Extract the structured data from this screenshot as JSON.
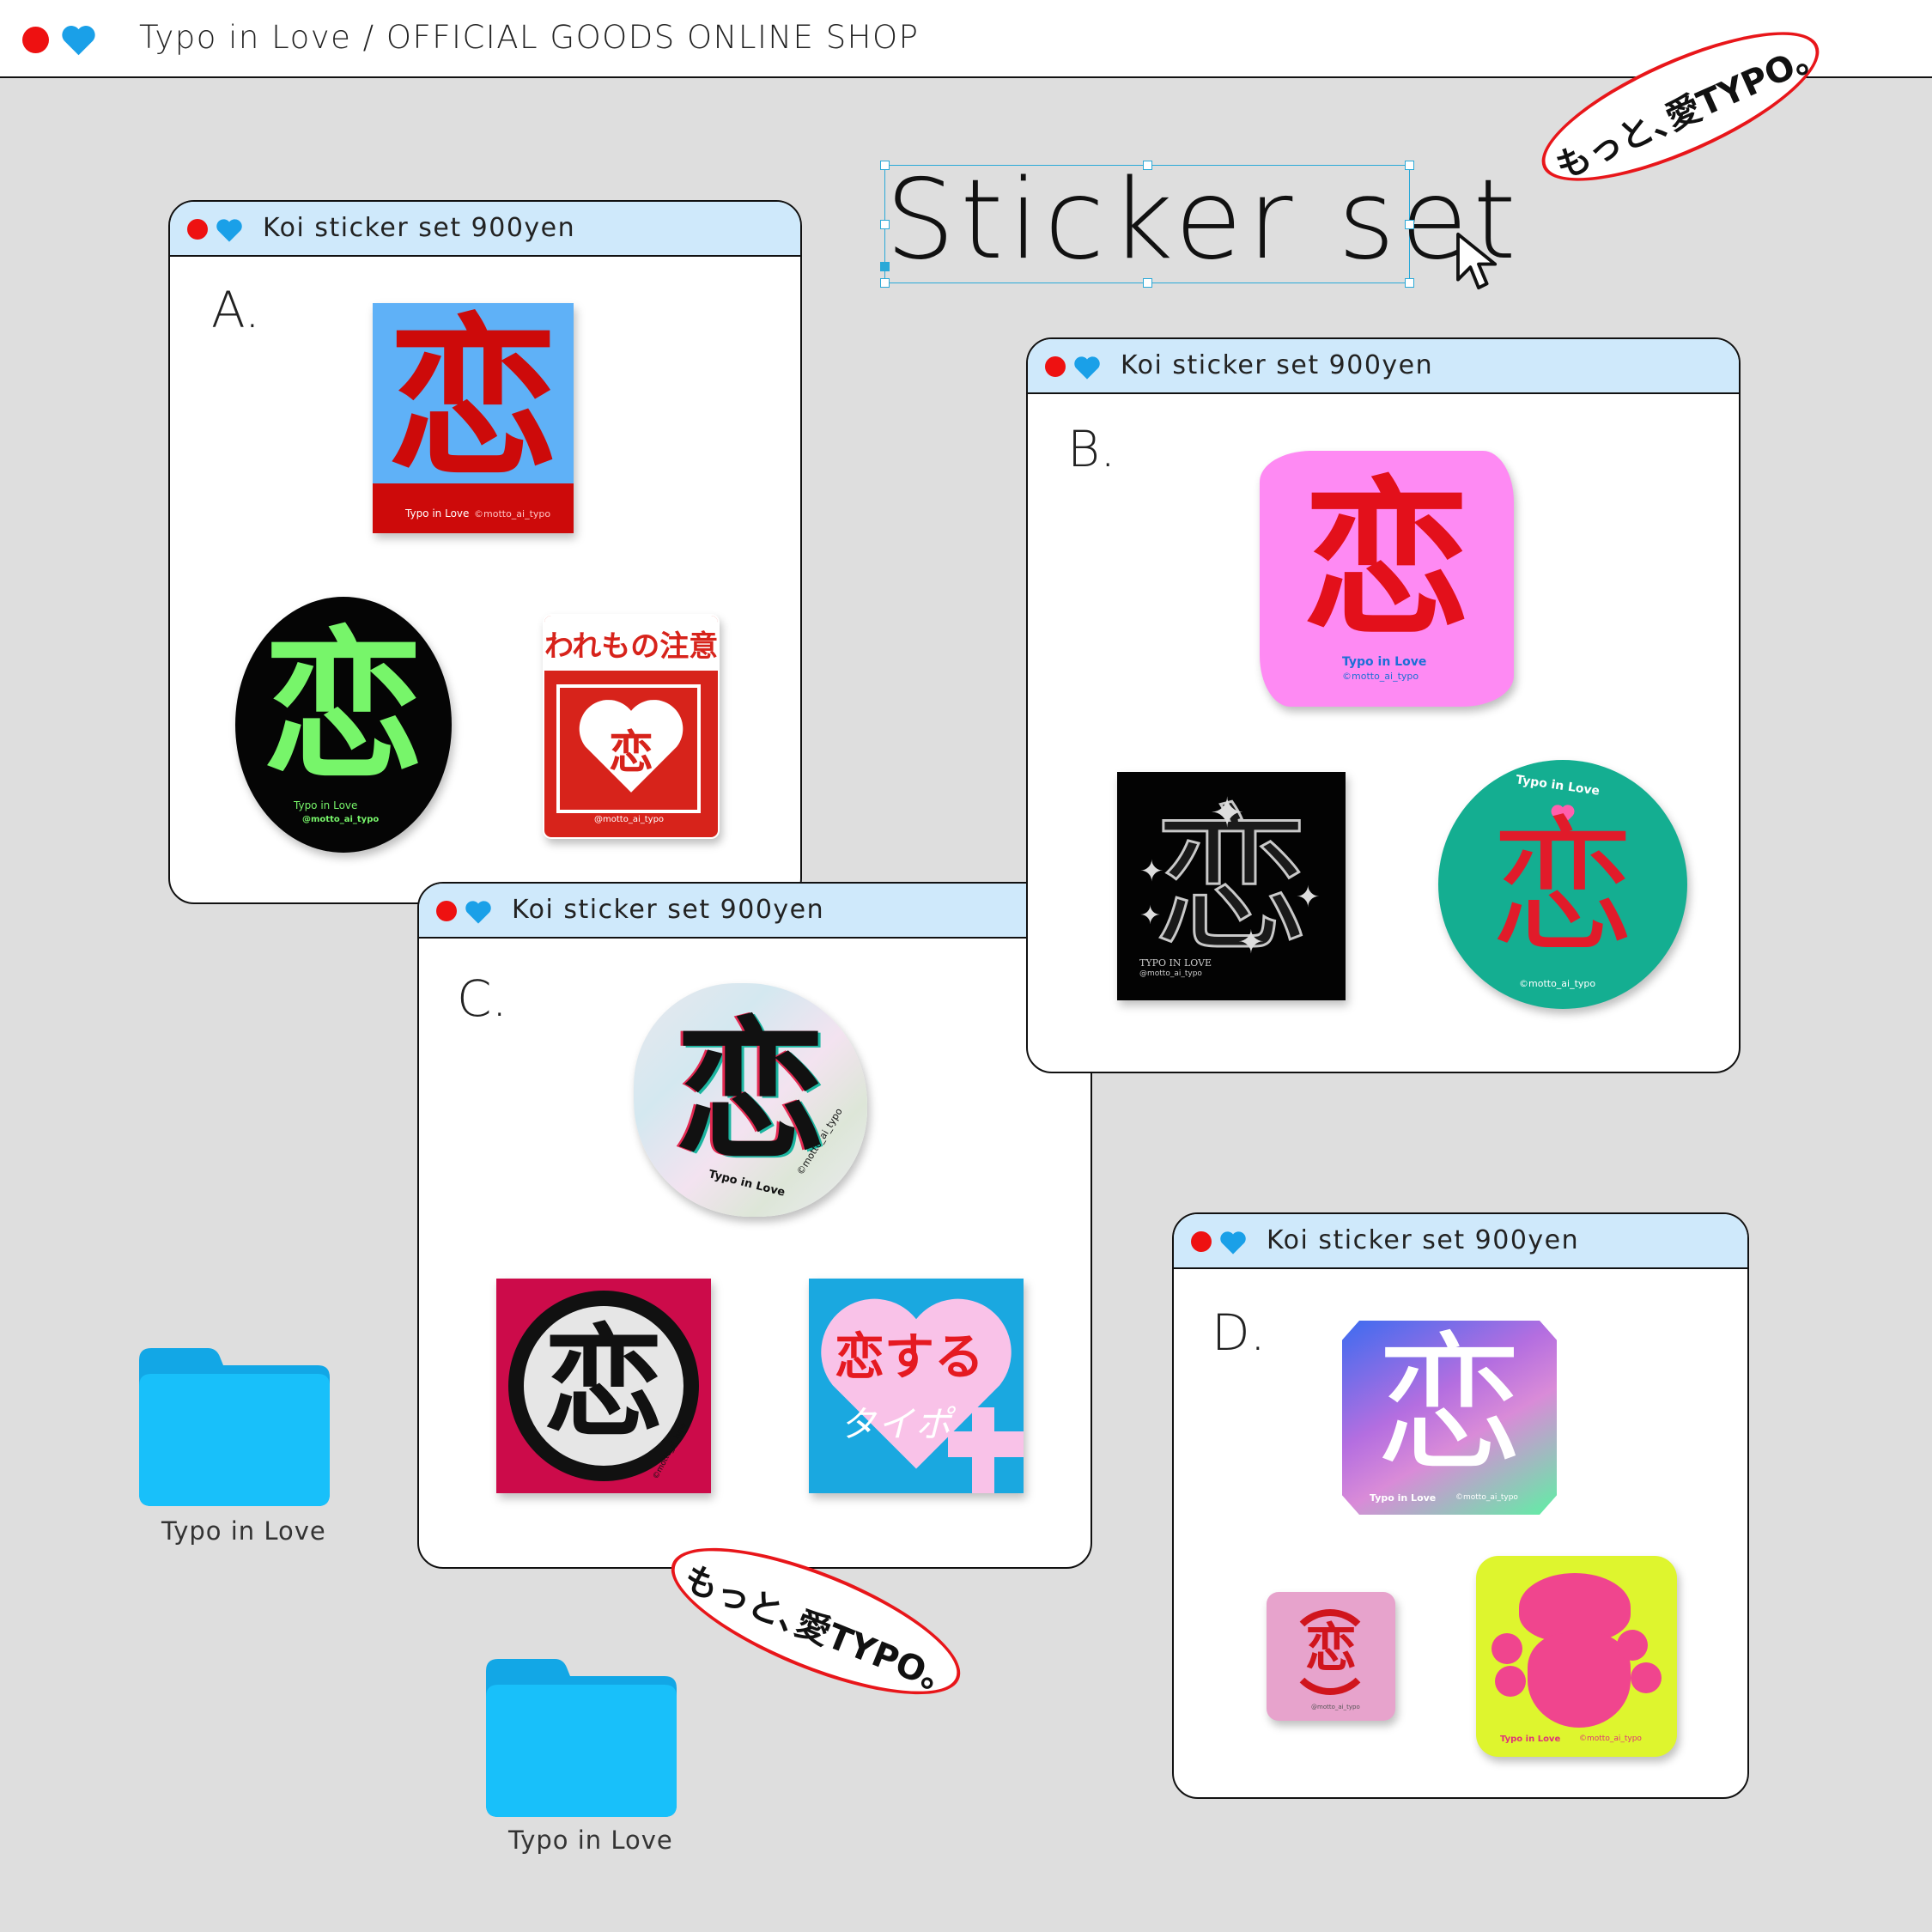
{
  "topbar": {
    "title": "Typo in Love / OFFICIAL GOODS ONLINE SHOP"
  },
  "page_title": "Sticker set",
  "badge_text": "もっと､愛TYPO｡",
  "windows": [
    {
      "title": "Koi sticker set  900yen",
      "letter": "A."
    },
    {
      "title": "Koi sticker set  900yen",
      "letter": "B."
    },
    {
      "title": "Koi sticker set  900yen",
      "letter": "C."
    },
    {
      "title": "Koi sticker set  900yen",
      "letter": "D."
    }
  ],
  "stickers": {
    "kanji": "恋",
    "brand": "Typo in Love",
    "handle": "@motto_ai_typo",
    "copyright_handle": "©motto_ai_typo",
    "fragile": "われもの注意",
    "suru": "恋する",
    "taipo": "タイポ",
    "typo_caps": "TYPO IN LOVE",
    "typo_spaced": "Typo in Love"
  },
  "folders": [
    {
      "label": "Typo in Love"
    },
    {
      "label": "Typo in Love"
    }
  ],
  "colors": {
    "red": "#ee1111",
    "blue": "#1aa0e8",
    "window_header": "#cfe9fb",
    "folder": "#18b9f5"
  }
}
